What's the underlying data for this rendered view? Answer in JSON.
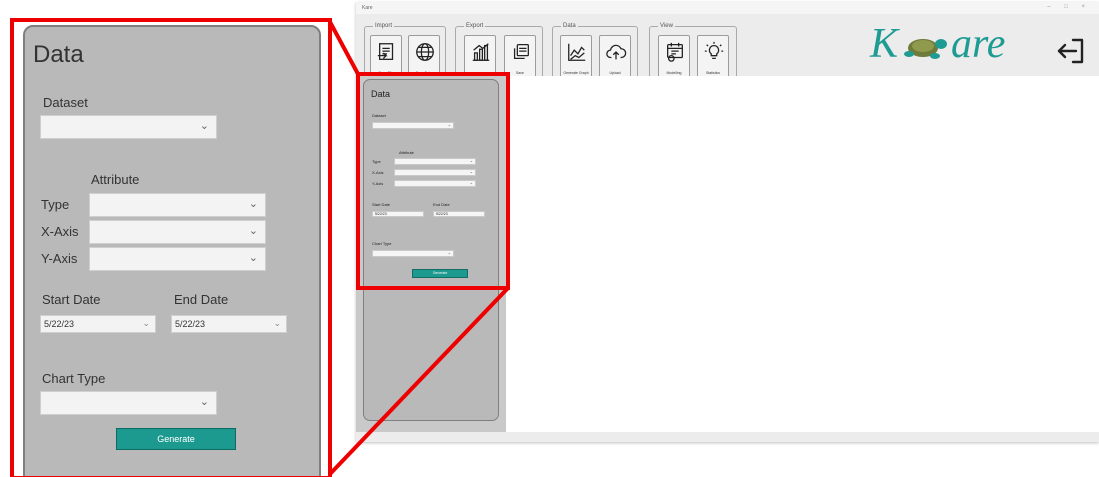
{
  "window": {
    "title": "Kare"
  },
  "toolbar": {
    "groups": [
      {
        "label": "Import",
        "tools": [
          {
            "label": "From File",
            "icon": "file-import-icon"
          },
          {
            "label": "Sync Data",
            "icon": "globe-icon"
          }
        ]
      },
      {
        "label": "Export",
        "tools": [
          {
            "label": "",
            "icon": "chart-export-icon"
          },
          {
            "label": "Save",
            "icon": "copy-icon"
          }
        ]
      },
      {
        "label": "Data",
        "tools": [
          {
            "label": "Generate Graph",
            "icon": "line-graph-icon"
          },
          {
            "label": "Upload",
            "icon": "cloud-upload-icon"
          }
        ]
      },
      {
        "label": "View",
        "tools": [
          {
            "label": "Modelling",
            "icon": "calendar-gear-icon"
          },
          {
            "label": "Statistics",
            "icon": "lightbulb-icon"
          }
        ]
      }
    ]
  },
  "logo": {
    "left": "K",
    "right": "are"
  },
  "panel": {
    "title": "Data",
    "dataset_label": "Dataset",
    "attribute_label": "Attribute",
    "type_label": "Type",
    "xaxis_label": "X-Axis",
    "yaxis_label": "Y-Axis",
    "start_label": "Start Date",
    "end_label": "End Date",
    "start_value": "5/22/23",
    "end_value": "5/22/23",
    "chart_type_label": "Chart Type",
    "generate_label": "Generate"
  },
  "colors": {
    "accent": "#1c9a8f",
    "highlight": "#ee0000",
    "panel": "#b9b9b9"
  }
}
